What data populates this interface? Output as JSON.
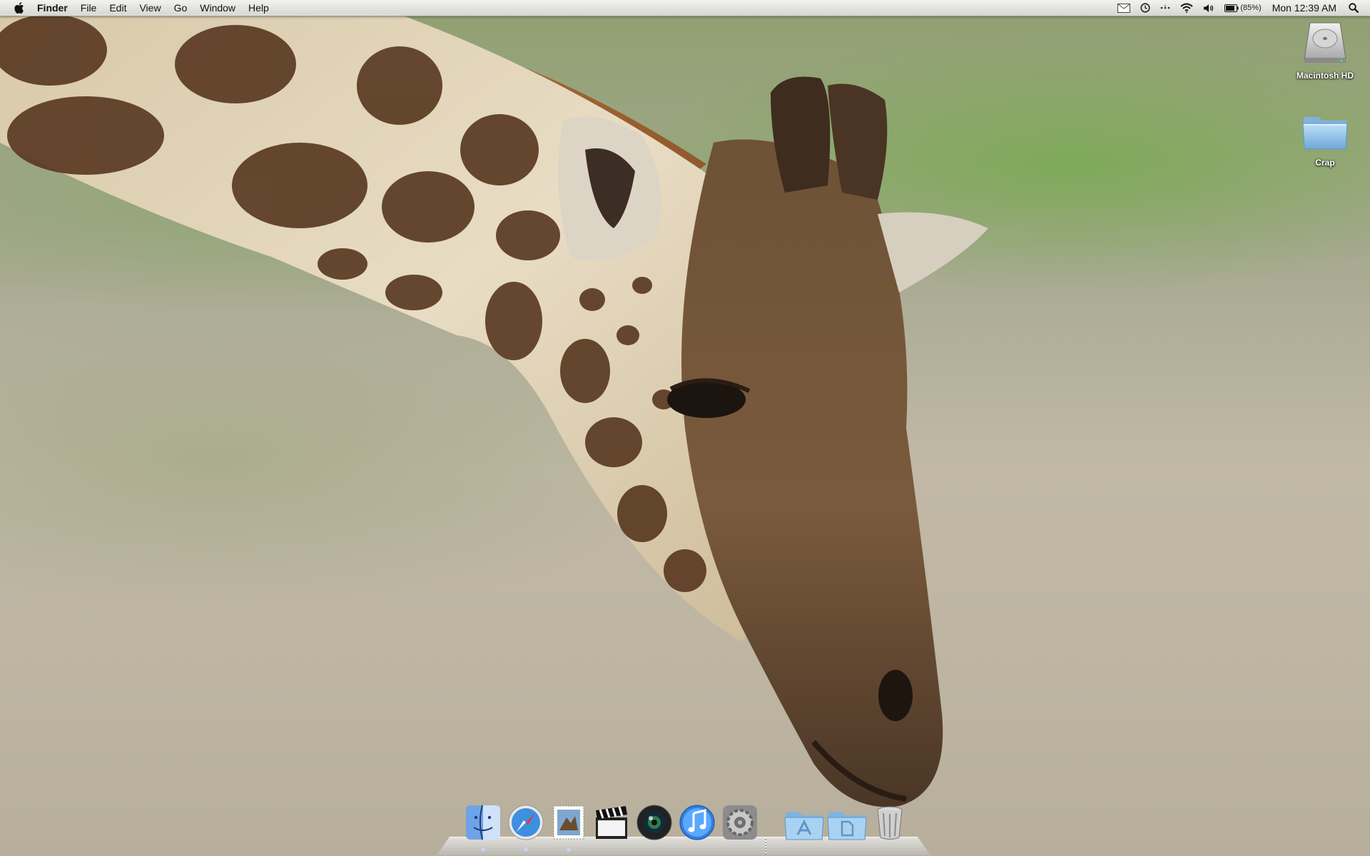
{
  "menubar": {
    "apple_icon": "apple-icon",
    "app_name": "Finder",
    "items": [
      "File",
      "Edit",
      "View",
      "Go",
      "Window",
      "Help"
    ],
    "status": {
      "icons": [
        "mail-icon",
        "time-machine-icon",
        "bluetooth-icon",
        "wifi-icon",
        "volume-icon",
        "battery-icon",
        "spotlight-icon"
      ],
      "battery_percent": "(85%)",
      "clock": "Mon 12:39 AM"
    }
  },
  "desktop": {
    "icons": [
      {
        "label": "Macintosh HD",
        "icon": "hard-drive-icon"
      },
      {
        "label": "Crap",
        "icon": "folder-icon"
      }
    ]
  },
  "dock": {
    "apps": [
      {
        "icon": "finder-icon",
        "running": true
      },
      {
        "icon": "safari-icon",
        "running": true
      },
      {
        "icon": "preview-icon",
        "running": true
      },
      {
        "icon": "clapperboard-icon",
        "running": false
      },
      {
        "icon": "photo-booth-icon",
        "running": false
      },
      {
        "icon": "itunes-icon",
        "running": false
      },
      {
        "icon": "system-preferences-icon",
        "running": false
      }
    ],
    "stacks": [
      {
        "icon": "applications-folder-icon"
      },
      {
        "icon": "documents-folder-icon"
      },
      {
        "icon": "trash-icon"
      }
    ]
  },
  "colors": {
    "menubar_top": "#fafafa",
    "menubar_bottom": "#dedede",
    "folder_blue": "#8fc0e8",
    "grass": "#7fae52"
  }
}
